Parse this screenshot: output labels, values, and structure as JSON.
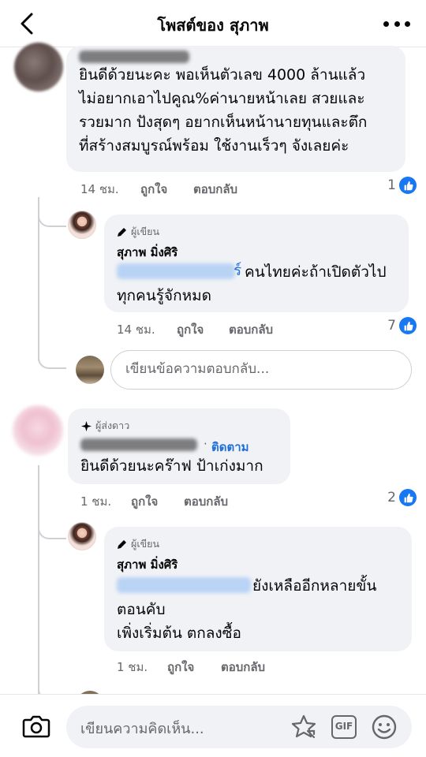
{
  "header": {
    "title": "โพสต์ของ สุภาพ",
    "back_icon": "chevron-left-icon",
    "more_icon": "more-horizontal-icon"
  },
  "comments": [
    {
      "text": "ยินดีด้วยนะคะ พอเห็นตัวเลข 4000 ล้านแล้ว\nไม่อยากเอาไปคูณ%ค่านายหน้าเลย สวยและ\nรวยมาก ปังสุดๆ อยากเห็นหน้านายทุนและตึก\nที่สร้างสมบูรณ์พร้อม ใช้งานเร็วๆ จังเลยค่ะ",
      "time": "14 ชม.",
      "like_label": "ถูกใจ",
      "reply_label": "ตอบกลับ",
      "reactions": "1",
      "replies": [
        {
          "badge": "ผู้เขียน",
          "name": "สุภาพ มิ่งศิริ",
          "mention_tail": "ร์",
          "text": "คนไทยค่ะถ้าเปิดตัวไป\nทุกคนรู้จักหมด",
          "time": "14 ชม.",
          "like_label": "ถูกใจ",
          "reply_label": "ตอบกลับ",
          "reactions": "7"
        }
      ],
      "reply_placeholder": "เขียนข้อความตอบกลับ..."
    },
    {
      "badge": "ผู้ส่งดาว",
      "follow_label": "ติดตาม",
      "dot": "·",
      "text": "ยินดีด้วยนะคร๊าฟ ป้าเก่งมาก",
      "time": "1 ชม.",
      "like_label": "ถูกใจ",
      "reply_label": "ตอบกลับ",
      "reactions": "2",
      "replies": [
        {
          "badge": "ผู้เขียน",
          "name": "สุภาพ มิ่งศิริ",
          "text_first": "ยังเหลืออีกหลายขั้น",
          "text_rest": "ตอนคับ\nเพิ่งเริ่มต้น ตกลงซื้อ",
          "time": "1 ชม.",
          "like_label": "ถูกใจ",
          "reply_label": "ตอบกลับ"
        }
      ]
    }
  ],
  "composer": {
    "placeholder": "เขียนความคิดเห็น...",
    "camera_icon": "camera-icon",
    "sticker_icon": "sticker-icon",
    "gif_label": "GIF",
    "emoji_icon": "emoji-icon"
  },
  "colors": {
    "link_blue": "#216fdb",
    "like_blue": "#1877f2",
    "bubble_bg": "#f0f2f5",
    "meta_gray": "#65676b"
  }
}
